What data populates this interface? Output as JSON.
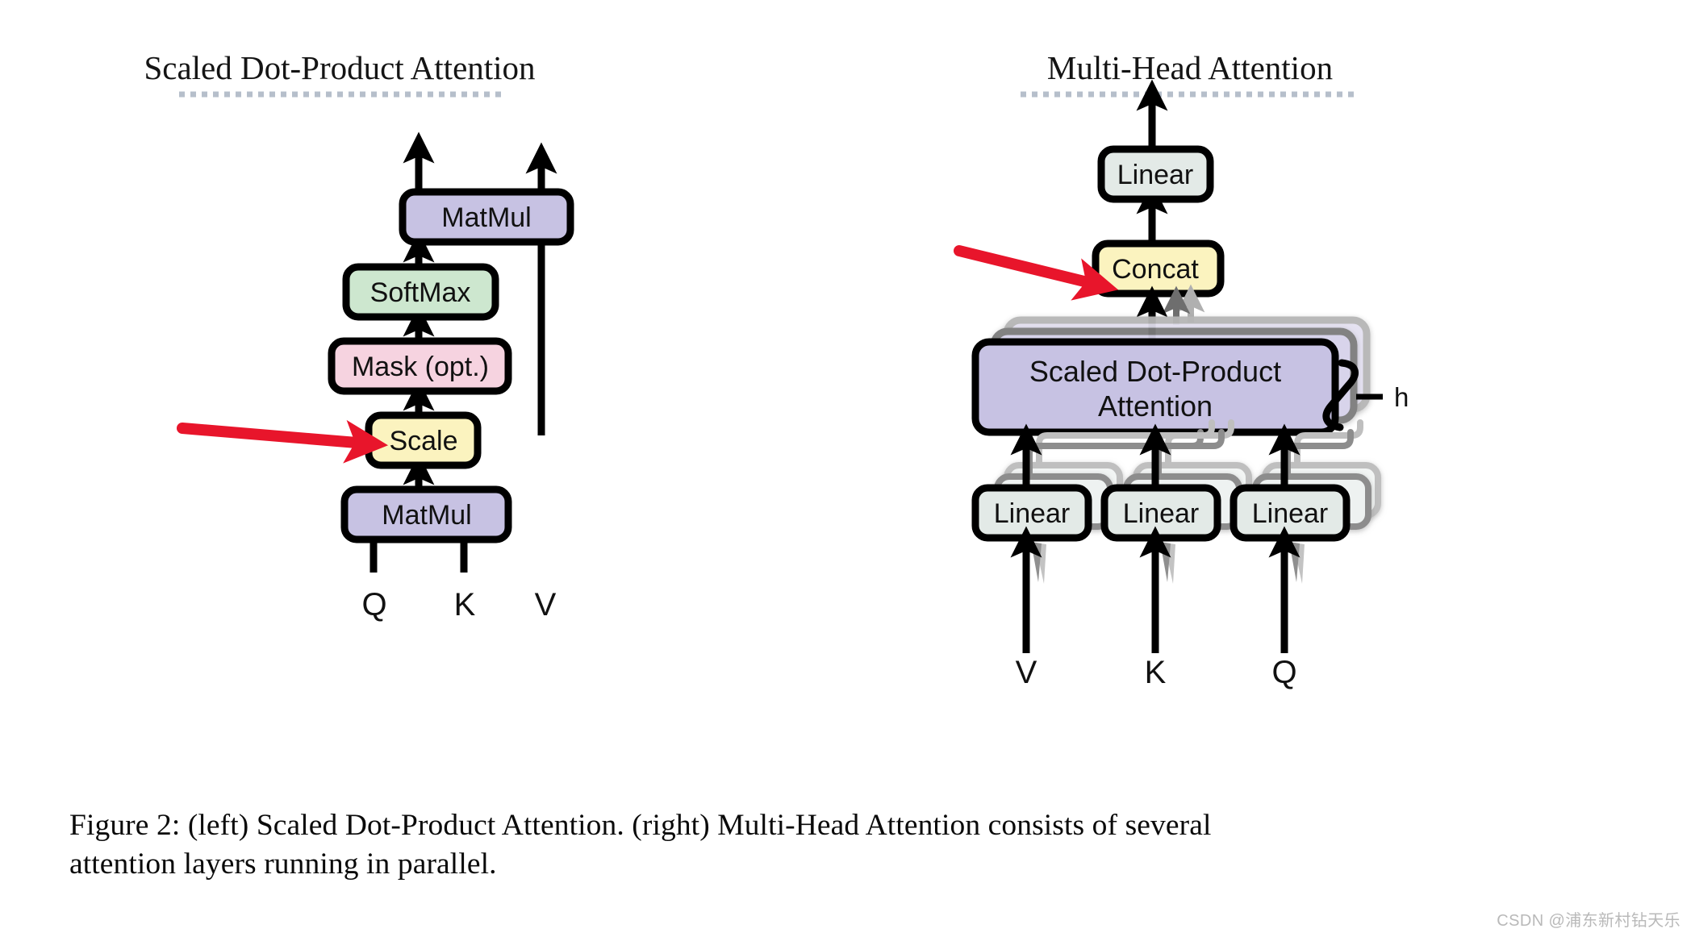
{
  "figure": {
    "left_panel": {
      "title": "Scaled Dot-Product Attention",
      "nodes": [
        {
          "id": "matmul-top",
          "label": "MatMul",
          "color": "#c7c2e3"
        },
        {
          "id": "softmax",
          "label": "SoftMax",
          "color": "#cde7cf"
        },
        {
          "id": "mask",
          "label": "Mask (opt.)",
          "color": "#f6d3e0"
        },
        {
          "id": "scale",
          "label": "Scale",
          "color": "#fbf3bf"
        },
        {
          "id": "matmul-bottom",
          "label": "MatMul",
          "color": "#c7c2e3"
        }
      ],
      "inputs": [
        "Q",
        "K",
        "V"
      ]
    },
    "right_panel": {
      "title": "Multi-Head Attention",
      "nodes": [
        {
          "id": "linear-out",
          "label": "Linear",
          "color": "#e3eae7"
        },
        {
          "id": "concat",
          "label": "Concat",
          "color": "#fbf3bf"
        },
        {
          "id": "sdpa",
          "label_line1": "Scaled Dot-Product",
          "label_line2": "Attention",
          "color": "#c7c2e3"
        },
        {
          "id": "linear-v",
          "label": "Linear",
          "color": "#e3eae7"
        },
        {
          "id": "linear-k",
          "label": "Linear",
          "color": "#e3eae7"
        },
        {
          "id": "linear-q",
          "label": "Linear",
          "color": "#e3eae7"
        }
      ],
      "heads_label": "h",
      "inputs": [
        "V",
        "K",
        "Q"
      ]
    },
    "annotations": [
      {
        "id": "arrow-to-scale",
        "target": "scale",
        "color": "#e8152b"
      },
      {
        "id": "arrow-to-concat",
        "target": "concat",
        "color": "#e8152b"
      }
    ],
    "caption": {
      "line1": "Figure 2:  (left) Scaled Dot-Product Attention.  (right) Multi-Head Attention consists of several",
      "line2": "attention layers running in parallel."
    },
    "watermark": "CSDN @浦东新村钻天乐"
  }
}
